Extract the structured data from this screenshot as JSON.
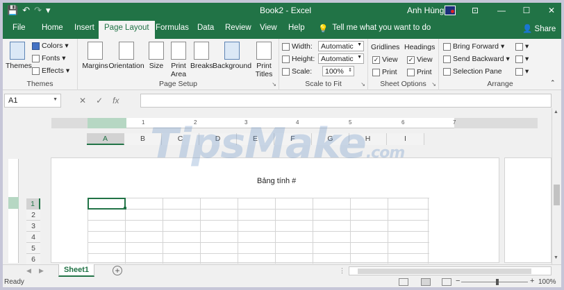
{
  "titlebar": {
    "title": "Book2 - Excel",
    "user": "Anh Hùng",
    "qat": {
      "save_icon": "💾",
      "undo_icon": "↶",
      "redo_icon": "↷",
      "customize_icon": "▾"
    },
    "controls": {
      "ribbon_display": "⊡",
      "minimize": "—",
      "maximize": "☐",
      "close": "✕"
    }
  },
  "tabs": [
    "File",
    "Home",
    "Insert",
    "Page Layout",
    "Formulas",
    "Data",
    "Review",
    "View",
    "Help"
  ],
  "active_tab": "Page Layout",
  "tell_me": {
    "icon": "💡",
    "text": "Tell me what you want to do"
  },
  "share": {
    "icon": "👤",
    "label": "Share"
  },
  "ribbon": {
    "themes": {
      "themes_btn": "Themes",
      "colors": "Colors",
      "fonts": "Fonts",
      "effects": "Effects",
      "group": "Themes"
    },
    "page_setup": {
      "margins": "Margins",
      "orientation": "Orientation",
      "size": "Size",
      "print_area_1": "Print",
      "print_area_2": "Area",
      "breaks": "Breaks",
      "background": "Background",
      "print_titles_1": "Print",
      "print_titles_2": "Titles",
      "group": "Page Setup"
    },
    "scale": {
      "width_label": "Width:",
      "width_value": "Automatic",
      "height_label": "Height:",
      "height_value": "Automatic",
      "scale_label": "Scale:",
      "scale_value": "100%",
      "group": "Scale to Fit"
    },
    "sheet_options": {
      "gridlines": "Gridlines",
      "headings": "Headings",
      "view1": "View",
      "print1": "Print",
      "view2": "View",
      "print2": "Print",
      "group": "Sheet Options"
    },
    "arrange": {
      "bring_forward": "Bring Forward",
      "send_backward": "Send Backward",
      "selection_pane": "Selection Pane",
      "group": "Arrange"
    }
  },
  "formula_bar": {
    "name_box": "A1",
    "cancel": "✕",
    "enter": "✓",
    "fx": "fx",
    "value": ""
  },
  "ruler": [
    "1",
    "2",
    "3",
    "4",
    "5",
    "6",
    "7"
  ],
  "columns": [
    "A",
    "B",
    "C",
    "D",
    "E",
    "F",
    "G",
    "H",
    "I"
  ],
  "rows": [
    "1",
    "2",
    "3",
    "4",
    "5",
    "6"
  ],
  "page_header": "Bảng tính #",
  "watermark": {
    "main": "TipsMake",
    "suffix": ".com"
  },
  "sheets": [
    "Sheet1"
  ],
  "add_sheet": "+",
  "status": {
    "text": "Ready",
    "zoom": "100%",
    "zoom_out": "−",
    "zoom_in": "+"
  }
}
